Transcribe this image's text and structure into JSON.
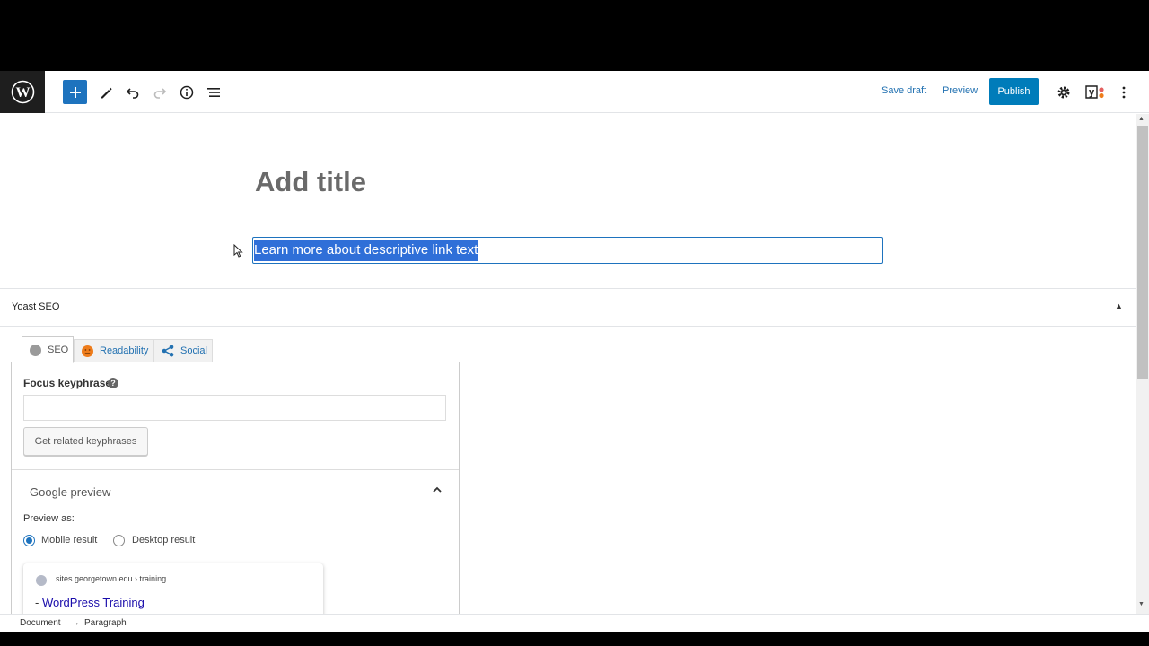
{
  "toolbar": {
    "save_draft_label": "Save draft",
    "preview_label": "Preview",
    "publish_label": "Publish",
    "icons": [
      "wordpress-icon",
      "plus-icon",
      "pencil-icon",
      "undo-icon",
      "redo-icon",
      "info-icon",
      "list-view-icon",
      "gear-icon",
      "yoast-icon",
      "more-vertical-icon"
    ]
  },
  "editor": {
    "title_placeholder": "Add title",
    "paragraph_text": "Learn more about descriptive link text"
  },
  "yoast": {
    "panel_title": "Yoast SEO",
    "tabs": [
      {
        "label": "SEO"
      },
      {
        "label": "Readability"
      },
      {
        "label": "Social"
      }
    ],
    "focus_keyphrase_label": "Focus keyphrase",
    "focus_keyphrase_value": "",
    "related_button_label": "Get related keyphrases",
    "google_preview_title": "Google preview",
    "preview_as_label": "Preview as:",
    "radio_options": [
      {
        "label": "Mobile result",
        "checked": true
      },
      {
        "label": "Desktop result",
        "checked": false
      }
    ],
    "serp": {
      "url": "sites.georgetown.edu › training",
      "title_prefix": "- ",
      "title": "WordPress Training"
    }
  },
  "breadcrumb": {
    "items": [
      "Document",
      "Paragraph"
    ],
    "separator": "→"
  },
  "colors": {
    "accent": "#007cba",
    "selection": "#2f6fd8",
    "readability_face": "#ee7c1b"
  }
}
